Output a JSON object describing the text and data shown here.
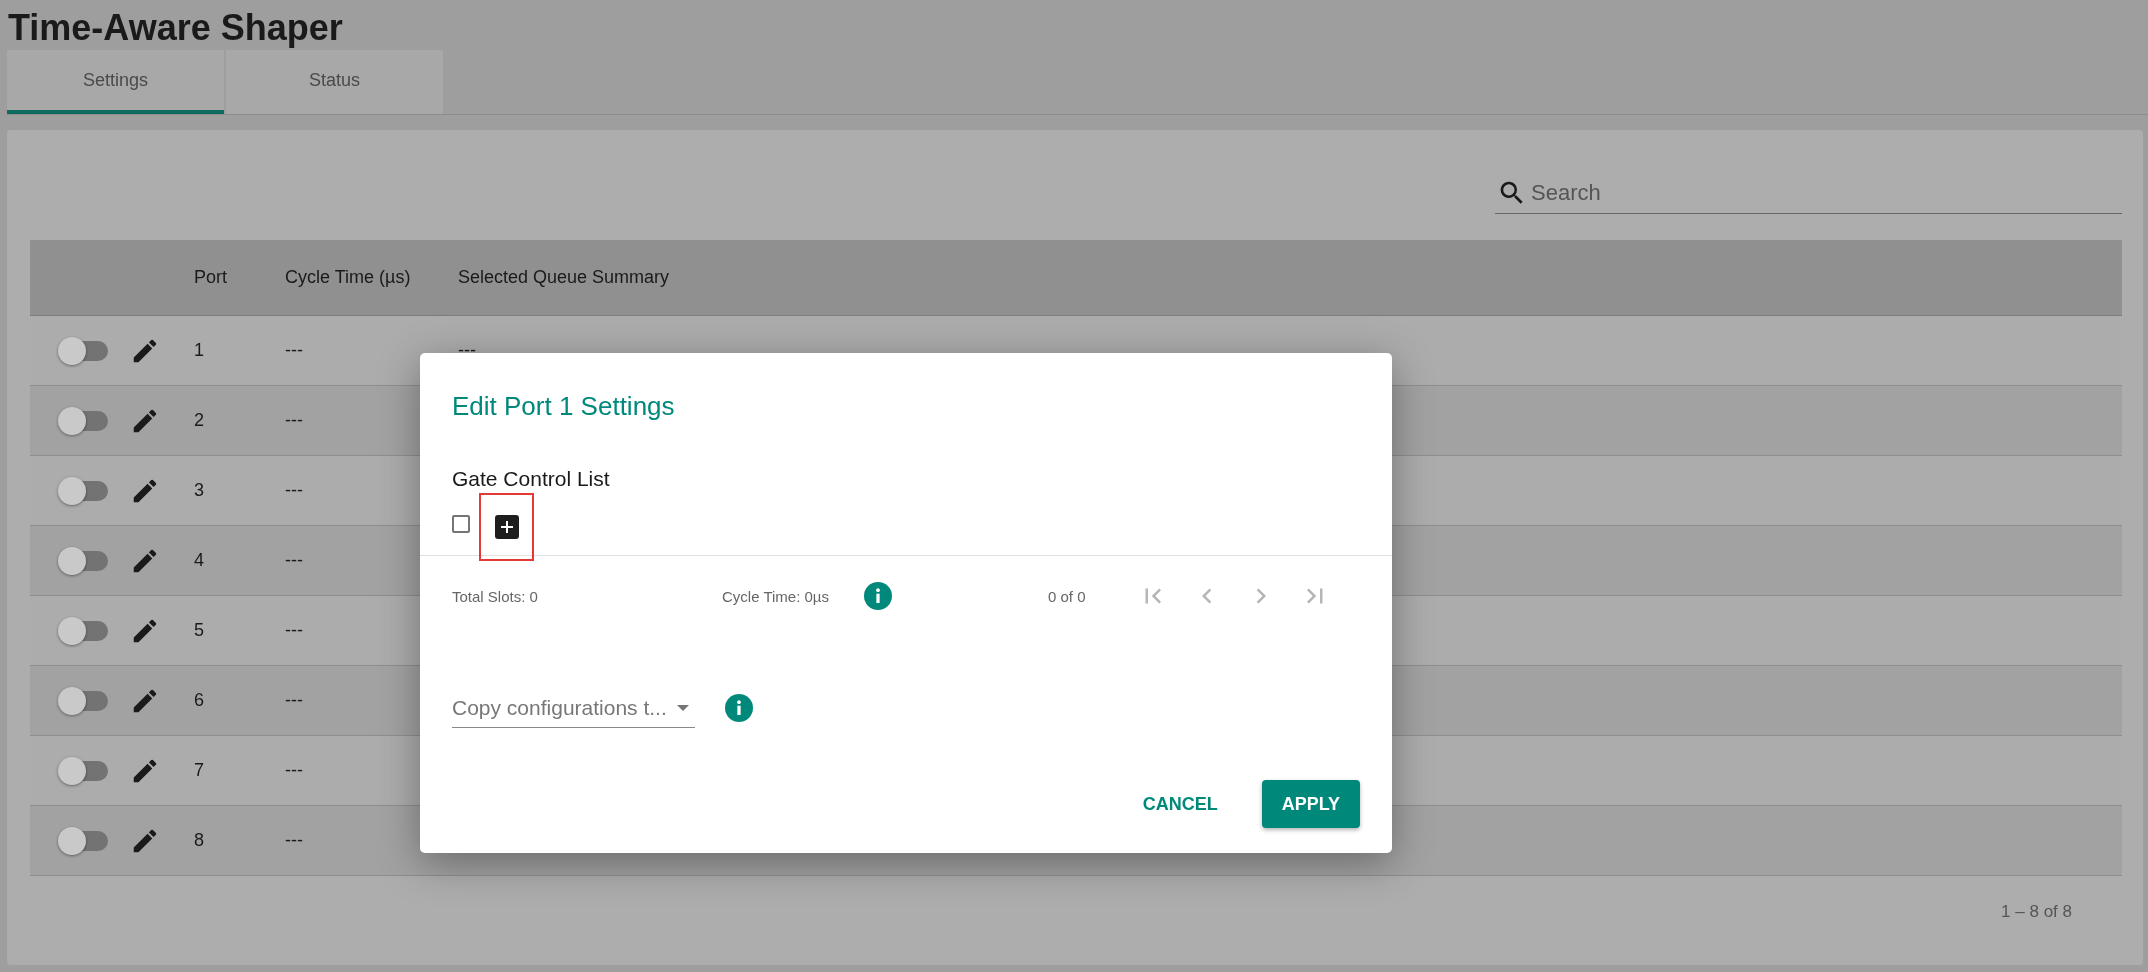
{
  "page": {
    "title": "Time-Aware Shaper"
  },
  "tabs": [
    {
      "label": "Settings",
      "selected": true
    },
    {
      "label": "Status",
      "selected": false
    }
  ],
  "search": {
    "placeholder": "Search"
  },
  "table": {
    "columns": [
      "Port",
      "Cycle Time (µs)",
      "Selected Queue Summary"
    ],
    "rows": [
      {
        "enabled": false,
        "port": "1",
        "cycle_time": "---",
        "summary": "---"
      },
      {
        "enabled": false,
        "port": "2",
        "cycle_time": "---"
      },
      {
        "enabled": false,
        "port": "3",
        "cycle_time": "---"
      },
      {
        "enabled": false,
        "port": "4",
        "cycle_time": "---"
      },
      {
        "enabled": false,
        "port": "5",
        "cycle_time": "---"
      },
      {
        "enabled": false,
        "port": "6",
        "cycle_time": "---"
      },
      {
        "enabled": false,
        "port": "7",
        "cycle_time": "---"
      },
      {
        "enabled": false,
        "port": "8",
        "cycle_time": "---"
      }
    ],
    "paginator": "1 – 8 of 8"
  },
  "dialog": {
    "title": "Edit Port 1 Settings",
    "section": "Gate Control List",
    "select_all_checked": false,
    "total_slots": "Total Slots: 0",
    "cycle_time": "Cycle Time: 0µs",
    "range": "0 of 0",
    "paging_disabled": true,
    "copy_placeholder": "Copy configurations t...",
    "buttons": [
      {
        "label": "CANCEL",
        "kind": "flat"
      },
      {
        "label": "APPLY",
        "kind": "raised"
      }
    ]
  }
}
